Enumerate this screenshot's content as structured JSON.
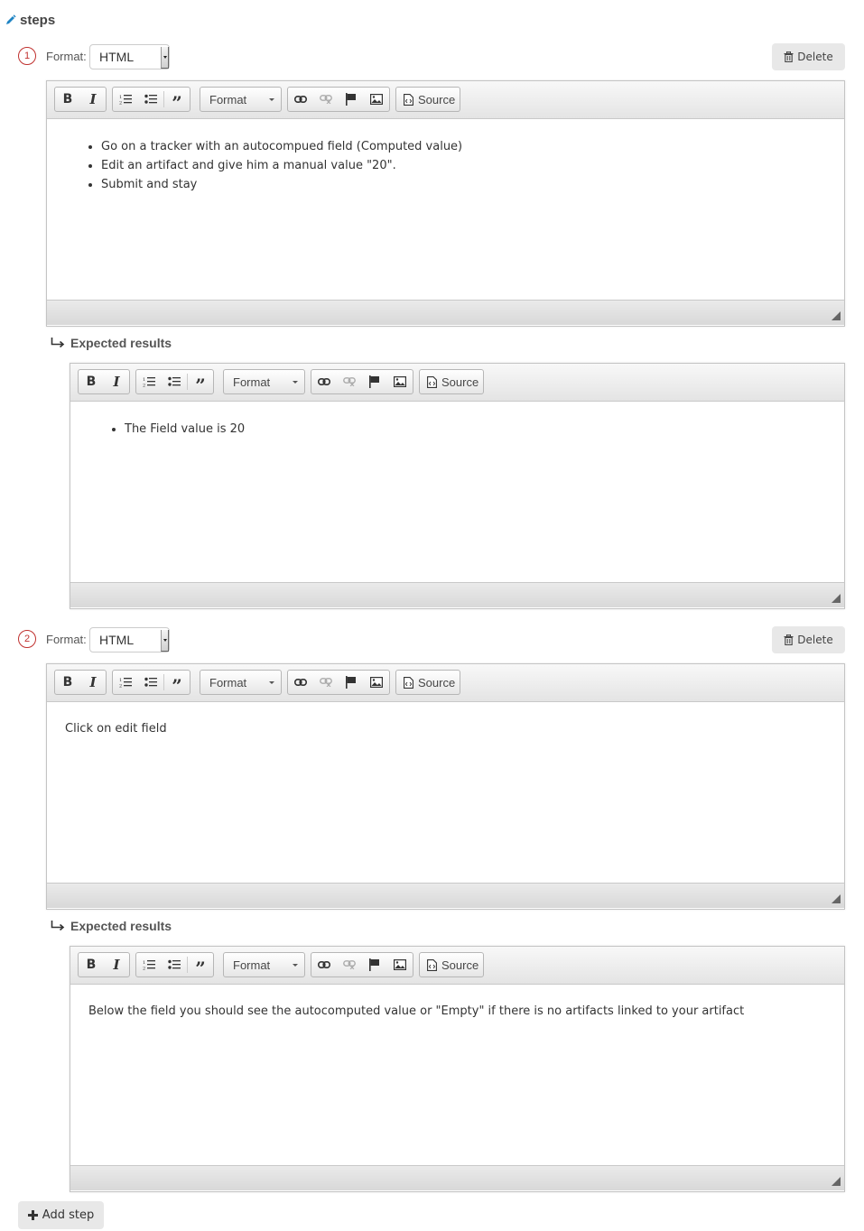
{
  "section": {
    "title": "steps",
    "icon": "pencil-icon"
  },
  "labels": {
    "format": "Format:",
    "delete": "Delete",
    "expected_results": "Expected results",
    "add_step": "Add step"
  },
  "toolbar": {
    "bold": "B",
    "italic": "I",
    "format_combo": "Format",
    "source": "Source"
  },
  "colors": {
    "step_number": "#c0312f",
    "pencil": "#1f84c4"
  },
  "steps": [
    {
      "number": "1",
      "format": "HTML",
      "description": {
        "type": "list",
        "items": [
          "Go on a tracker with an autocompued field (Computed value)",
          "Edit an artifact and give him a manual value \"20\".",
          "Submit and stay"
        ]
      },
      "expected": {
        "type": "list",
        "items": [
          "The Field value is 20"
        ]
      }
    },
    {
      "number": "2",
      "format": "HTML",
      "description": {
        "type": "paragraph",
        "text": "Click on edit field"
      },
      "expected": {
        "type": "paragraph",
        "text": "Below the field you should see the autocomputed value or \"Empty\" if there is no artifacts linked to your artifact"
      }
    }
  ]
}
